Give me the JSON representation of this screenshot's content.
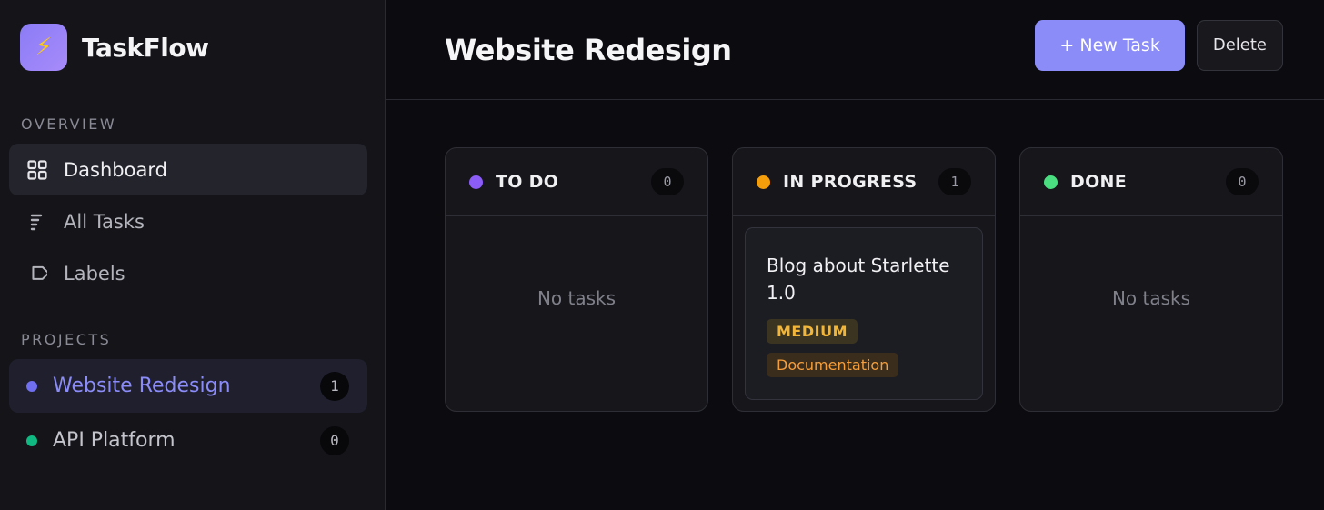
{
  "app": {
    "name": "TaskFlow",
    "logo_glyph": "⚡"
  },
  "sidebar": {
    "overview_label": "OVERVIEW",
    "nav": [
      {
        "label": "Dashboard",
        "icon": "grid-icon",
        "active": true
      },
      {
        "label": "All Tasks",
        "icon": "list-icon",
        "active": false
      },
      {
        "label": "Labels",
        "icon": "tag-icon",
        "active": false
      }
    ],
    "projects_label": "PROJECTS",
    "projects": [
      {
        "name": "Website Redesign",
        "count": "1",
        "color": "#6f6ff0",
        "active": true
      },
      {
        "name": "API Platform",
        "count": "0",
        "color": "#10b981",
        "active": false
      }
    ]
  },
  "header": {
    "title": "Website Redesign",
    "new_task_label": "+ New Task",
    "delete_label": "Delete"
  },
  "board": {
    "columns": [
      {
        "title": "TO DO",
        "count": "0",
        "color": "#8b5cf6",
        "empty_text": "No tasks"
      },
      {
        "title": "IN PROGRESS",
        "count": "1",
        "color": "#f59e0b",
        "cards": [
          {
            "title": "Blog about Starlette 1.0",
            "priority": "MEDIUM",
            "label": "Documentation"
          }
        ]
      },
      {
        "title": "DONE",
        "count": "0",
        "color": "#4ade80",
        "empty_text": "No tasks"
      }
    ]
  },
  "colors": {
    "accent": "#8b8cf8",
    "background": "#0c0c10",
    "sidebar": "#141419"
  }
}
